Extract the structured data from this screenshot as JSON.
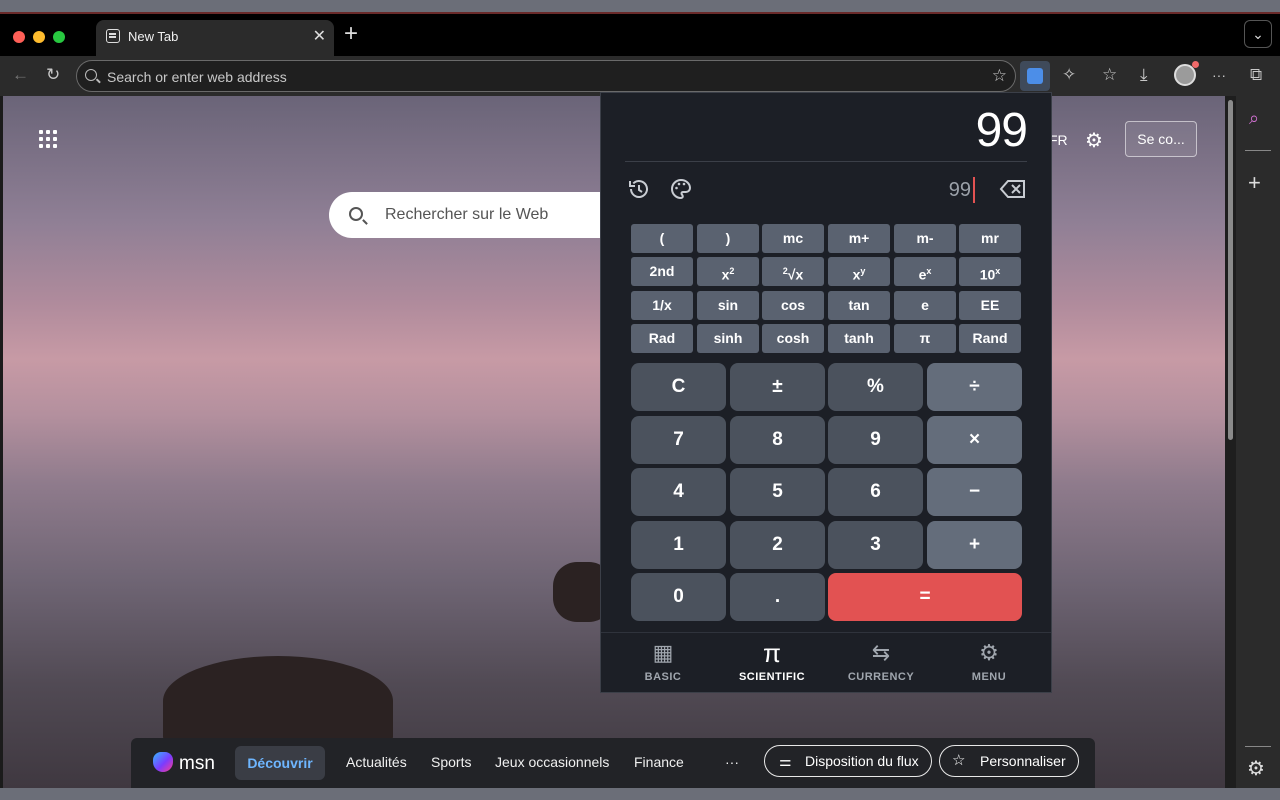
{
  "browser": {
    "tab_title": "New Tab",
    "tab_close": "✕",
    "new_tab": "+",
    "tab_dropdown": "⌄",
    "address_placeholder": "Search or enter web address",
    "icons": {
      "back": "←",
      "reload": "↻",
      "star": "☆",
      "extensions": "✧",
      "favorites": "☆",
      "downloads": "⤓",
      "more": "···",
      "split": "⧉"
    }
  },
  "newtab": {
    "search_placeholder": "Rechercher sur le Web",
    "lang": "FR",
    "gear": "⚙",
    "signin": "Se co..."
  },
  "msn": {
    "logo": "msn",
    "active": "Découvrir",
    "items": [
      "Actualités",
      "Sports",
      "Jeux occasionnels",
      "Finance",
      "···"
    ],
    "feed_layout": "Disposition du flux",
    "personalize": "Personnaliser"
  },
  "sidebar": {
    "search": "⌕",
    "add": "+",
    "settings": "⚙"
  },
  "calculator": {
    "display": "99",
    "input": "99",
    "scientific_keys": [
      [
        "(",
        ")",
        "mc",
        "m+",
        "m-",
        "mr"
      ],
      [
        "2nd",
        "x2",
        "2√x",
        "xy",
        "ex",
        "10x"
      ],
      [
        "1/x",
        "sin",
        "cos",
        "tan",
        "e",
        "EE"
      ],
      [
        "Rad",
        "sinh",
        "cosh",
        "tanh",
        "π",
        "Rand"
      ]
    ],
    "keys": {
      "clear": "C",
      "sign": "±",
      "percent": "%",
      "divide": "÷",
      "seven": "7",
      "eight": "8",
      "nine": "9",
      "multiply": "×",
      "four": "4",
      "five": "5",
      "six": "6",
      "minus": "−",
      "one": "1",
      "two": "2",
      "three": "3",
      "plus": "+",
      "zero": "0",
      "dot": ".",
      "equals": "="
    },
    "tabs": [
      {
        "label": "BASIC",
        "icon": "▦"
      },
      {
        "label": "SCIENTIFIC",
        "icon": "π"
      },
      {
        "label": "CURRENCY",
        "icon": "⇆"
      },
      {
        "label": "MENU",
        "icon": "⚙"
      }
    ],
    "active_tab": "SCIENTIFIC",
    "colors": {
      "equals": "#e25252",
      "panel": "#1c1f26"
    }
  }
}
